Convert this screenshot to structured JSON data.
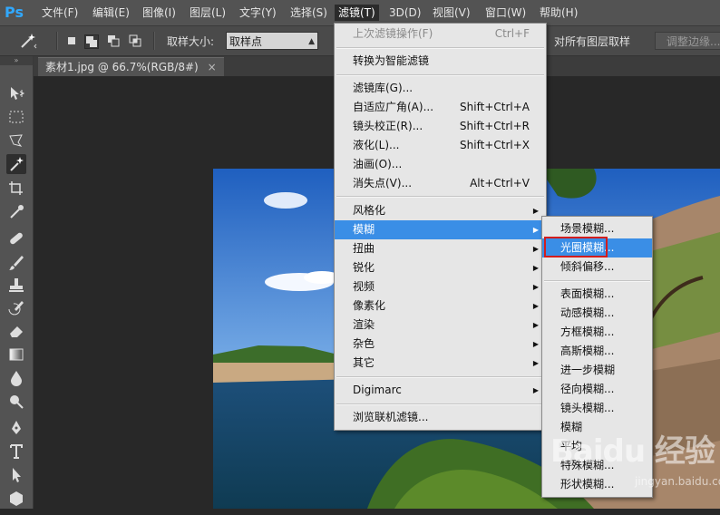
{
  "app": {
    "logo": "Ps"
  },
  "menubar": {
    "items": [
      {
        "label": "文件(F)"
      },
      {
        "label": "编辑(E)"
      },
      {
        "label": "图像(I)"
      },
      {
        "label": "图层(L)"
      },
      {
        "label": "文字(Y)"
      },
      {
        "label": "选择(S)"
      },
      {
        "label": "滤镜(T)"
      },
      {
        "label": "3D(D)"
      },
      {
        "label": "视图(V)"
      },
      {
        "label": "窗口(W)"
      },
      {
        "label": "帮助(H)"
      }
    ],
    "active": "滤镜(T)"
  },
  "options_bar": {
    "tool_icon": "magic-wand-icon",
    "sample_size_label": "取样大小:",
    "sample_size_value": "取样点",
    "sample_all_layers": "对所有图层取样",
    "refine_edge": "调整边缘..."
  },
  "document": {
    "tab_title": "素材1.jpg @ 66.7%(RGB/8#)",
    "close_glyph": "×"
  },
  "toolbar": {
    "grip": "»",
    "tools": [
      "move-icon",
      "marquee-icon",
      "lasso-icon",
      "magic-wand-icon",
      "crop-icon",
      "eyedropper-icon",
      "healing-brush-icon",
      "brush-icon",
      "clone-stamp-icon",
      "history-brush-icon",
      "eraser-icon",
      "gradient-icon",
      "blur-tool-icon",
      "dodge-icon",
      "pen-icon",
      "type-icon",
      "path-selection-icon",
      "shape-icon"
    ],
    "active_tool": "magic-wand-icon"
  },
  "filter_menu": {
    "last_filter": {
      "label": "上次滤镜操作(F)",
      "shortcut": "Ctrl+F"
    },
    "smart_filters": "转换为智能滤镜",
    "group1": [
      {
        "label": "滤镜库(G)...",
        "shortcut": ""
      },
      {
        "label": "自适应广角(A)...",
        "shortcut": "Shift+Ctrl+A"
      },
      {
        "label": "镜头校正(R)...",
        "shortcut": "Shift+Ctrl+R"
      },
      {
        "label": "液化(L)...",
        "shortcut": "Shift+Ctrl+X"
      },
      {
        "label": "油画(O)...",
        "shortcut": ""
      },
      {
        "label": "消失点(V)...",
        "shortcut": "Alt+Ctrl+V"
      }
    ],
    "submenus": [
      {
        "label": "风格化"
      },
      {
        "label": "模糊"
      },
      {
        "label": "扭曲"
      },
      {
        "label": "锐化"
      },
      {
        "label": "视频"
      },
      {
        "label": "像素化"
      },
      {
        "label": "渲染"
      },
      {
        "label": "杂色"
      },
      {
        "label": "其它"
      }
    ],
    "highlighted": "模糊",
    "digimarc": "Digimarc",
    "browse_online": "浏览联机滤镜..."
  },
  "blur_submenu": {
    "group1": [
      "场景模糊...",
      "光圈模糊...",
      "倾斜偏移..."
    ],
    "group2": [
      "表面模糊...",
      "动感模糊...",
      "方框模糊...",
      "高斯模糊...",
      "进一步模糊",
      "径向模糊...",
      "镜头模糊...",
      "模糊",
      "平均",
      "特殊模糊...",
      "形状模糊..."
    ],
    "highlighted": "光圈模糊..."
  },
  "watermark": {
    "text": "Baidu 经验",
    "sub": "jingyan.baidu.com"
  },
  "colors": {
    "highlight": "#3a8ee6",
    "annotation": "#d21d1d",
    "ps_blue": "#31a8ff"
  }
}
